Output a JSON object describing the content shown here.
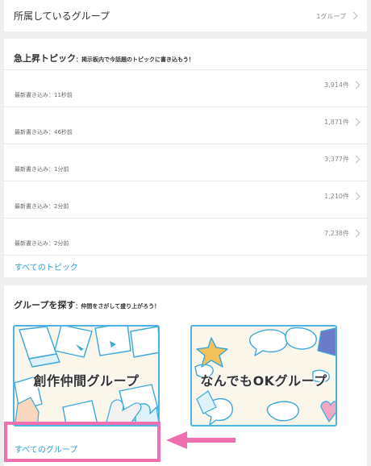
{
  "groups": {
    "title": "所属しているグループ",
    "count": "1グループ"
  },
  "topics": {
    "heading": "急上昇トピック",
    "subheading": "：掲示板内で今話題のトピックに書き込もう！",
    "items": [
      {
        "count": "3,914件",
        "time": "最新書き込み：11秒前"
      },
      {
        "count": "1,871件",
        "time": "最新書き込み：46秒前"
      },
      {
        "count": "3,377件",
        "time": "最新書き込み：1分前"
      },
      {
        "count": "1,210件",
        "time": "最新書き込み：2分前"
      },
      {
        "count": "7,238件",
        "time": "最新書き込み：2分前"
      }
    ],
    "all_link": "すべてのトピック"
  },
  "find": {
    "heading": "グループを探す",
    "subheading": "：仲間をさがして盛り上がろう！",
    "banners": [
      {
        "label": "創作仲間グループ"
      },
      {
        "label": "なんでもOKグループ"
      }
    ],
    "all_link": "すべてのグループ"
  },
  "colors": {
    "link": "#2aa0dc",
    "highlight": "#f06fb0",
    "banner_border": "#4bb3e6"
  }
}
